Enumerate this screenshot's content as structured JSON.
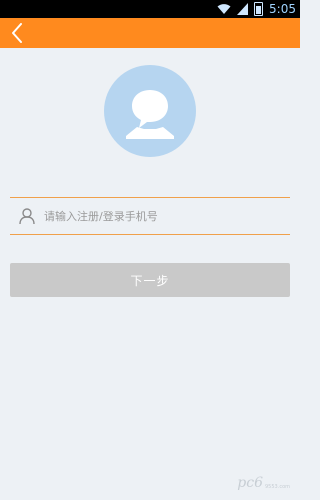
{
  "status_bar": {
    "time": "5:05"
  },
  "login": {
    "phone_placeholder": "请输入注册/登录手机号",
    "next_label": "下一步"
  },
  "watermark": {
    "main": "pc6",
    "sub": "9553.com"
  },
  "colors": {
    "accent": "#ff8a1e",
    "background": "#edf1f5",
    "avatar": "#b6d5f0",
    "button_disabled": "#c9c9c9",
    "field_line": "#f0a04a"
  },
  "icons": [
    "wifi-icon",
    "signal-icon",
    "battery-icon",
    "back-arrow-icon",
    "avatar-icon",
    "user-icon"
  ]
}
